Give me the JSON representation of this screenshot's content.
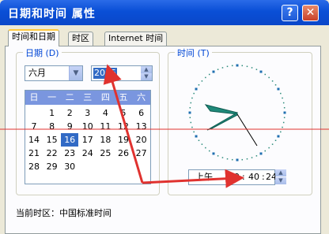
{
  "window": {
    "title": "日期和时间 属性",
    "help_label": "?",
    "close_label": "✕"
  },
  "tabs": [
    {
      "label": "时间和日期",
      "active": true
    },
    {
      "label": "时区",
      "active": false
    },
    {
      "label": "Internet 时间",
      "active": false
    }
  ],
  "date_group": {
    "title": "日期 (D)",
    "month": "六月",
    "year": "2015"
  },
  "calendar": {
    "weekdays": [
      "日",
      "一",
      "二",
      "三",
      "四",
      "五",
      "六"
    ],
    "weeks": [
      [
        "",
        "1",
        "2",
        "3",
        "4",
        "5",
        "6"
      ],
      [
        "7",
        "8",
        "9",
        "10",
        "11",
        "12",
        "13"
      ],
      [
        "14",
        "15",
        "16",
        "17",
        "18",
        "19",
        "20"
      ],
      [
        "21",
        "22",
        "23",
        "24",
        "25",
        "26",
        "27"
      ],
      [
        "28",
        "29",
        "30",
        "",
        "",
        "",
        ""
      ]
    ],
    "selected_day": "16"
  },
  "time_group": {
    "title": "时间 (T)",
    "ampm": "上午",
    "hours": "09",
    "minutes": "40",
    "seconds": "24",
    "sep": ":"
  },
  "timezone": {
    "label": "当前时区：中国标准时间"
  },
  "colors": {
    "accent": "#0a47c9",
    "annotation": "#e0322f",
    "selection": "#316ac5"
  }
}
